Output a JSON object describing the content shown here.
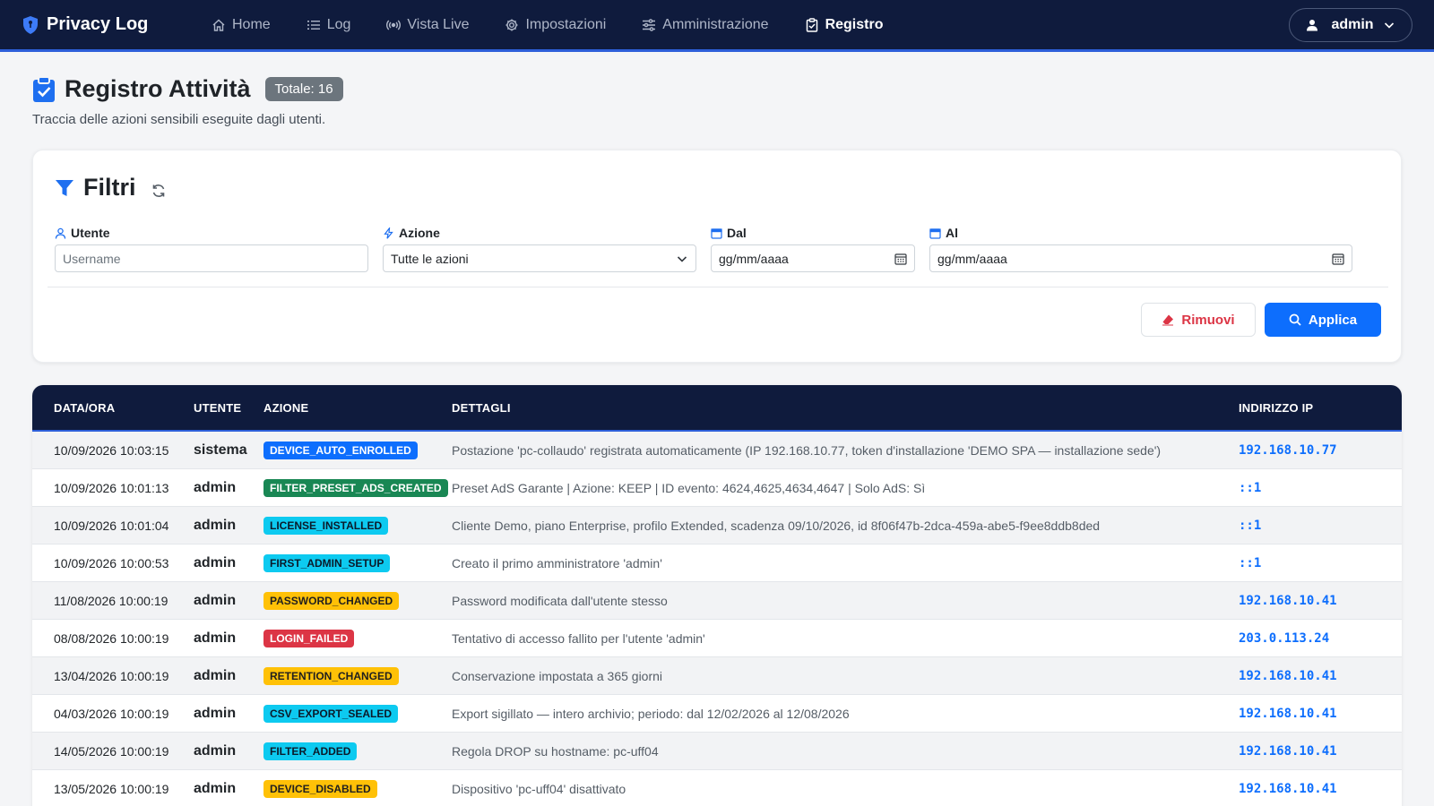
{
  "navbar": {
    "brand": "Privacy Log",
    "items": [
      {
        "label": "Home",
        "icon": "home-icon",
        "active": false
      },
      {
        "label": "Log",
        "icon": "list-icon",
        "active": false
      },
      {
        "label": "Vista Live",
        "icon": "broadcast-icon",
        "active": false
      },
      {
        "label": "Impostazioni",
        "icon": "gear-icon",
        "active": false
      },
      {
        "label": "Amministrazione",
        "icon": "sliders-icon",
        "active": false
      },
      {
        "label": "Registro",
        "icon": "clipboard-check-icon",
        "active": true
      }
    ],
    "user": "admin"
  },
  "header": {
    "title": "Registro Attività",
    "total": "Totale: 16",
    "subtitle": "Traccia delle azioni sensibili eseguite dagli utenti."
  },
  "filters": {
    "title": "Filtri",
    "user_label": "Utente",
    "user_placeholder": "Username",
    "action_label": "Azione",
    "action_value": "Tutte le azioni",
    "from_label": "Dal",
    "from_value": "gg/mm/aaaa",
    "to_label": "Al",
    "to_value": "gg/mm/aaaa",
    "remove_label": "Rimuovi",
    "apply_label": "Applica"
  },
  "table": {
    "headers": {
      "date": "DATA/ORA",
      "user": "UTENTE",
      "action": "AZIONE",
      "details": "DETTAGLI",
      "ip": "INDIRIZZO IP"
    },
    "rows": [
      {
        "date": "10/09/2026 10:03:15",
        "user": "sistema",
        "action": "DEVICE_AUTO_ENROLLED",
        "badge": "blue",
        "details": "Postazione 'pc-collaudo' registrata automaticamente (IP 192.168.10.77, token d'installazione 'DEMO SPA — installazione sede')",
        "ip": "192.168.10.77"
      },
      {
        "date": "10/09/2026 10:01:13",
        "user": "admin",
        "action": "FILTER_PRESET_ADS_CREATED",
        "badge": "green",
        "details": "Preset AdS Garante | Azione: KEEP | ID evento: 4624,4625,4634,4647 | Solo AdS: Sì",
        "ip": "::1"
      },
      {
        "date": "10/09/2026 10:01:04",
        "user": "admin",
        "action": "LICENSE_INSTALLED",
        "badge": "cyan",
        "details": "Cliente Demo, piano Enterprise, profilo Extended, scadenza 09/10/2026, id 8f06f47b-2dca-459a-abe5-f9ee8ddb8ded",
        "ip": "::1"
      },
      {
        "date": "10/09/2026 10:00:53",
        "user": "admin",
        "action": "FIRST_ADMIN_SETUP",
        "badge": "cyan",
        "details": "Creato il primo amministratore 'admin'",
        "ip": "::1"
      },
      {
        "date": "11/08/2026 10:00:19",
        "user": "admin",
        "action": "PASSWORD_CHANGED",
        "badge": "yellow",
        "details": "Password modificata dall'utente stesso",
        "ip": "192.168.10.41"
      },
      {
        "date": "08/08/2026 10:00:19",
        "user": "admin",
        "action": "LOGIN_FAILED",
        "badge": "red",
        "details": "Tentativo di accesso fallito per l'utente 'admin'",
        "ip": "203.0.113.24"
      },
      {
        "date": "13/04/2026 10:00:19",
        "user": "admin",
        "action": "RETENTION_CHANGED",
        "badge": "yellow",
        "details": "Conservazione impostata a 365 giorni",
        "ip": "192.168.10.41"
      },
      {
        "date": "04/03/2026 10:00:19",
        "user": "admin",
        "action": "CSV_EXPORT_SEALED",
        "badge": "cyan",
        "details": "Export sigillato — intero archivio; periodo: dal 12/02/2026 al 12/08/2026",
        "ip": "192.168.10.41"
      },
      {
        "date": "14/05/2026 10:00:19",
        "user": "admin",
        "action": "FILTER_ADDED",
        "badge": "cyan",
        "details": "Regola DROP su hostname: pc-uff04",
        "ip": "192.168.10.41"
      },
      {
        "date": "13/05/2026 10:00:19",
        "user": "admin",
        "action": "DEVICE_DISABLED",
        "badge": "yellow",
        "details": "Dispositivo 'pc-uff04' disattivato",
        "ip": "192.168.10.41"
      }
    ]
  },
  "badge_colors": {
    "blue": {
      "bg": "#0d6efd",
      "fg": "#ffffff"
    },
    "green": {
      "bg": "#198754",
      "fg": "#ffffff"
    },
    "cyan": {
      "bg": "#0dcaf0",
      "fg": "#0b1a2a"
    },
    "yellow": {
      "bg": "#ffc107",
      "fg": "#1f1f1f"
    },
    "red": {
      "bg": "#dc3545",
      "fg": "#ffffff"
    }
  },
  "colors": {
    "navbar_bg": "#0f1b3d",
    "accent": "#2d5fd9",
    "primary": "#0d6efd",
    "danger": "#dc3545"
  }
}
